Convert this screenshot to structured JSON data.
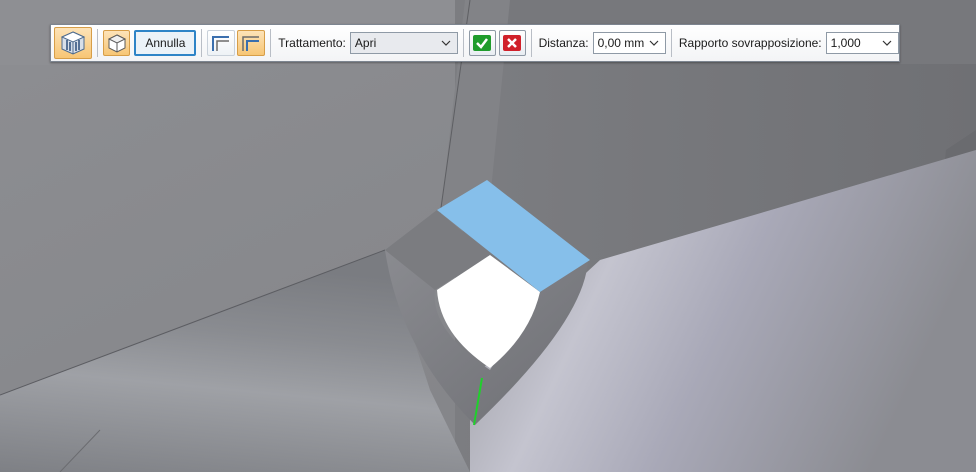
{
  "toolbar": {
    "cancel_label": "Annulla",
    "treatment_label": "Trattamento:",
    "treatment_value": "Apri",
    "distance_label": "Distanza:",
    "distance_value": "0,00 mm",
    "overlap_label": "Rapporto sovrapposizione:",
    "overlap_value": "1,000"
  },
  "icons": {
    "select_step": "view-cube-icon",
    "face_step": "cube-face-icon",
    "treatment_open": "corner-open-icon",
    "treatment_closed": "corner-closed-icon",
    "accept": "checkmark-icon",
    "cancel": "x-icon",
    "dropdown": "chevron-down-icon"
  },
  "colors": {
    "toolbar_active": "#f7c675",
    "accept_green": "#1f9c2c",
    "cancel_red": "#d0202a",
    "highlight_face": "#86bfea",
    "highlight_edge": "#1fd12b",
    "model_gray": "#8a8b8f"
  }
}
